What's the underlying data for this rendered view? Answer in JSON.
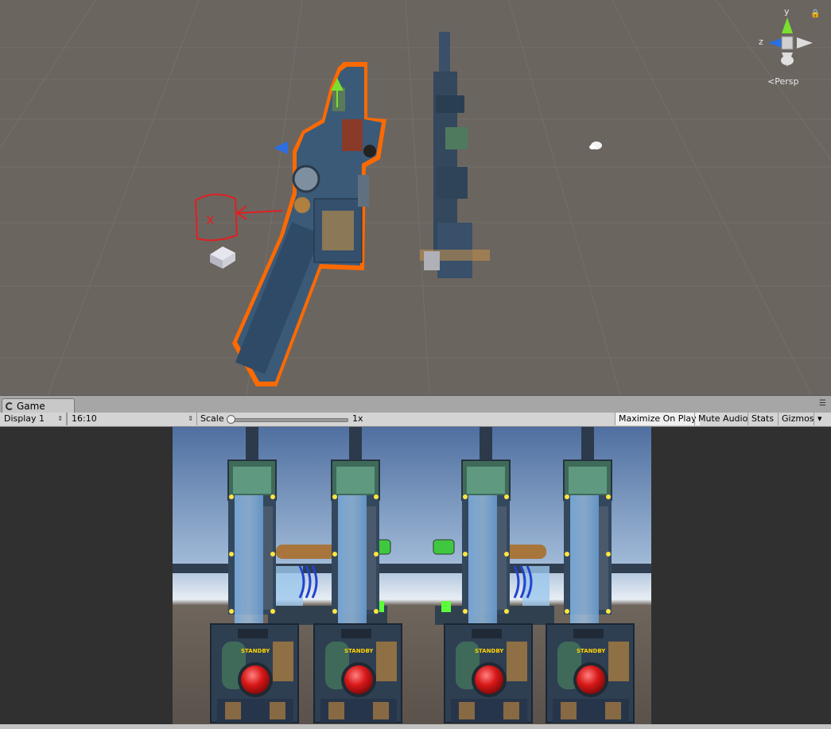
{
  "scene": {
    "gizmo": {
      "y_label": "y",
      "z_label": "z"
    },
    "projection_label": "Persp",
    "annotation_mark": "x",
    "colors": {
      "background": "#6b6560",
      "grid": "#7a746f",
      "selection": "#ff6a00",
      "annotation": "#e02020"
    }
  },
  "game_panel": {
    "tab_label": "Game",
    "display_select": "Display 1",
    "aspect_select": "16:10",
    "scale_label": "Scale",
    "scale_value": "1x",
    "buttons": {
      "maximize_on_play": "Maximize On Play",
      "mute_audio": "Mute Audio",
      "stats": "Stats",
      "gizmos": "Gizmos"
    },
    "machine_sign": "STANDBY"
  }
}
